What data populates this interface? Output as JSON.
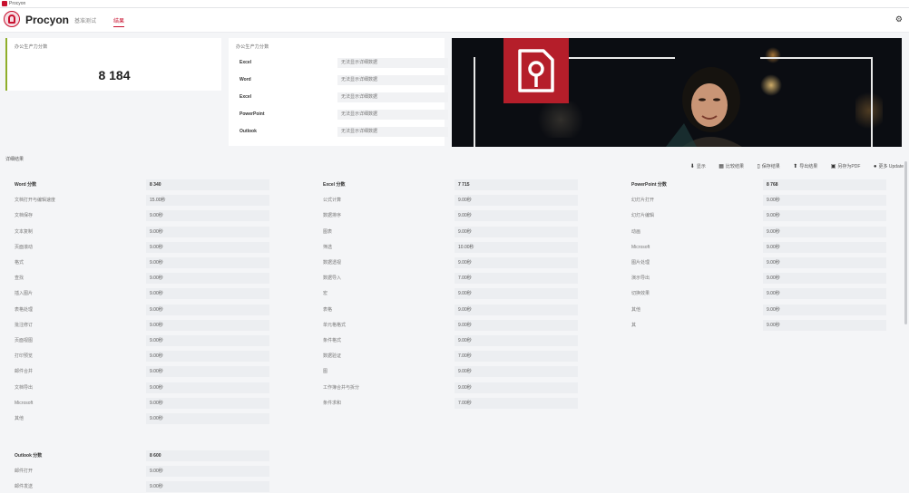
{
  "window": {
    "title": "Procyon"
  },
  "header": {
    "app_name": "Procyon",
    "tabs": [
      {
        "label": "基准测试"
      },
      {
        "label": "结果"
      }
    ]
  },
  "score_card": {
    "label": "办公生产力分数",
    "value": "8 184"
  },
  "sub_scores": {
    "label": "办公生产力分数",
    "rows": [
      {
        "name": "Excel",
        "value": "无法显示详细数据"
      },
      {
        "name": "Word",
        "value": "无法显示详细数据"
      },
      {
        "name": "Excel",
        "value": "无法显示详细数据"
      },
      {
        "name": "PowerPoint",
        "value": "无法显示详细数据"
      },
      {
        "name": "Outlook",
        "value": "无法显示详细数据"
      }
    ]
  },
  "results": {
    "label": "详细结果"
  },
  "toolbar": [
    {
      "label": "显示",
      "icon": "download-icon"
    },
    {
      "label": "比较结果",
      "icon": "bar-chart-icon"
    },
    {
      "label": "保存结果",
      "icon": "document-icon"
    },
    {
      "label": "导出结果",
      "icon": "upload-icon"
    },
    {
      "label": "另存为PDF",
      "icon": "save-icon"
    },
    {
      "label": "更多 Update",
      "icon": "user-icon"
    }
  ],
  "columns": [
    {
      "header": "Word 分数",
      "value_header": "8 340",
      "names": [
        "文档打开与编辑速度",
        "文档保存",
        "文本复制",
        "页面滚动",
        "格式",
        "查找",
        "插入图片",
        "表格处理",
        "批注修订",
        "页面视图",
        "打印预览",
        "邮件合并",
        "文档导出",
        "Microsoft",
        "其他"
      ],
      "values": [
        "15.00秒",
        "9.00秒",
        "9.00秒",
        "9.00秒",
        "9.00秒",
        "9.00秒",
        "9.00秒",
        "9.00秒",
        "9.00秒",
        "9.00秒",
        "9.00秒",
        "9.00秒",
        "9.00秒",
        "9.00秒",
        "9.00秒"
      ]
    },
    {
      "header": "Excel 分数",
      "value_header": "7 715",
      "names": [
        "公式计算",
        "数据排序",
        "图表",
        "筛选",
        "数据透视",
        "数据导入",
        "宏",
        "表格",
        "单元格格式",
        "条件格式",
        "数据验证",
        "图",
        "工作簿合并与拆分",
        "条件求和"
      ],
      "values": [
        "9.00秒",
        "9.00秒",
        "9.00秒",
        "10.00秒",
        "9.00秒",
        "7.00秒",
        "9.00秒",
        "9.00秒",
        "9.00秒",
        "9.00秒",
        "7.00秒",
        "9.00秒",
        "9.00秒",
        "7.00秒"
      ]
    },
    {
      "header": "PowerPoint 分数",
      "value_header": "8 768",
      "names": [
        "幻灯片打开",
        "幻灯片编辑",
        "动画",
        "Microsoft",
        "图片处理",
        "演示导出",
        "切换效果",
        "其他",
        "其"
      ],
      "values": [
        "9.00秒",
        "9.00秒",
        "9.00秒",
        "9.00秒",
        "9.00秒",
        "9.00秒",
        "9.00秒",
        "9.00秒",
        "9.00秒"
      ]
    }
  ],
  "outlook_block": {
    "header": "Outlook 分数",
    "value_header": "8 600",
    "names": [
      "邮件打开",
      "邮件发送"
    ],
    "values": [
      "9.00秒",
      "9.00秒"
    ]
  }
}
